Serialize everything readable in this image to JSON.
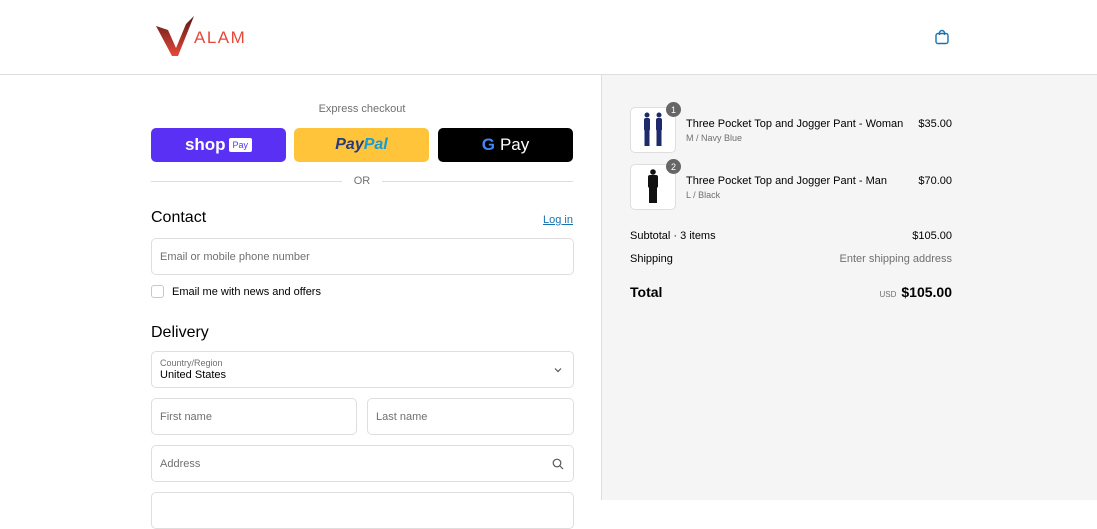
{
  "header": {
    "brand": "ALAM",
    "cart_icon": "shopping-bag-icon"
  },
  "express": {
    "label": "Express checkout",
    "shop_label": "shop",
    "shop_tag": "Pay",
    "paypal_a": "Pay",
    "paypal_b": "Pal",
    "gpay_g": "G",
    "gpay_label": "Pay",
    "or": "OR"
  },
  "contact": {
    "title": "Contact",
    "login": "Log in",
    "email_placeholder": "Email or mobile phone number",
    "newsletter": "Email me with news and offers"
  },
  "delivery": {
    "title": "Delivery",
    "country_label": "Country/Region",
    "country_value": "United States",
    "first_name": "First name",
    "last_name": "Last name",
    "address": "Address"
  },
  "summary": {
    "items": [
      {
        "qty": "1",
        "name": "Three Pocket Top and Jogger Pant - Woman",
        "variant": "M / Navy Blue",
        "price": "$35.00"
      },
      {
        "qty": "2",
        "name": "Three Pocket Top and Jogger Pant - Man",
        "variant": "L / Black",
        "price": "$70.00"
      }
    ],
    "subtotal_label": "Subtotal · 3 items",
    "subtotal": "$105.00",
    "shipping_label": "Shipping",
    "shipping_value": "Enter shipping address",
    "total_label": "Total",
    "currency": "USD",
    "total": "$105.00"
  },
  "colors": {
    "shop_pay": "#5a31f4",
    "paypal": "#ffc439",
    "link": "#1773b0",
    "brand": "#e5483a"
  }
}
